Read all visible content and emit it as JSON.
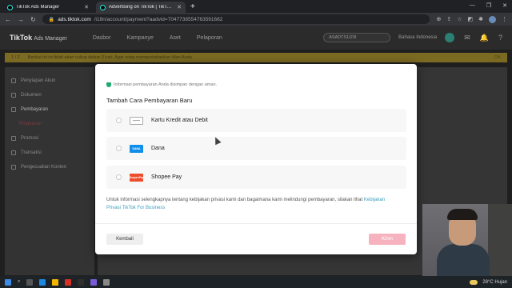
{
  "browser": {
    "tabs": [
      {
        "title": "TikTok Ads Manager",
        "active": false
      },
      {
        "title": "Advertising on TikTok | TikTok Ad",
        "active": true
      }
    ],
    "url_domain": "ads.tiktok.com",
    "url_path": "/i18n/account/payment?aadvid=7047738554763591682"
  },
  "app": {
    "logo": "TikTok",
    "logo_sub": "Ads Manager",
    "nav": [
      "Dasbor",
      "Kampanye",
      "Aset",
      "Pelaporan"
    ],
    "account_label": "ASADTS1I23I",
    "language": "Bahasa Indonesia",
    "notice_step": "1 / 2",
    "notice_text": "Berikut ini ini tidak akan cukup dalam 3 hari. Agar tetap mempertahankan iklan Anda",
    "notice_ok": "OK"
  },
  "sidebar": {
    "items": [
      {
        "label": "Penyiapan Akun",
        "sub": false
      },
      {
        "label": "Dokumen",
        "sub": false
      },
      {
        "label": "Pembayaran",
        "sub": false
      },
      {
        "label": "Ringkasan",
        "sub": true
      },
      {
        "label": "Promosi",
        "sub": false
      },
      {
        "label": "Transaksi",
        "sub": false
      },
      {
        "label": "Pengecualian Konten",
        "sub": false
      }
    ]
  },
  "modal": {
    "secure_note": "Informasi pembayaran Anda disimpan dengan aman.",
    "title": "Tambah Cara Pembayaran Baru",
    "options": [
      {
        "label": "Kartu Kredit atau Debit",
        "icon": "credit-card-icon",
        "icon_text": ""
      },
      {
        "label": "Dana",
        "icon": "dana-logo-icon",
        "icon_text": "DANA"
      },
      {
        "label": "Shopee Pay",
        "icon": "shopeepay-logo-icon",
        "icon_text": "ShopeePay"
      }
    ],
    "privacy_text": "Untuk informasi selengkapnya tentang kebijakan privasi kami dan bagaimana kami melindungi pembayaran, silakan lihat",
    "privacy_link": "Kebijakan Privasi TikTok For Business",
    "back_label": "Kembali",
    "submit_label": "Kirim"
  },
  "taskbar": {
    "weather": "28°C  Hujan"
  },
  "colors": {
    "accent": "#fe2c55",
    "submit_disabled": "#f6b3bf",
    "link": "#3d9fbd",
    "secure_green": "#1fa86f"
  }
}
